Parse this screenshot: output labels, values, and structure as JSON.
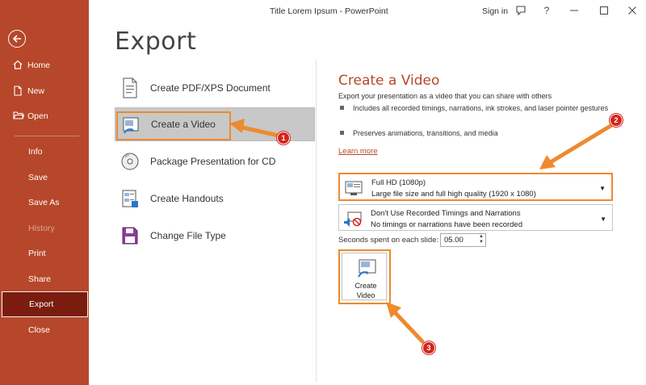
{
  "window": {
    "title": "Title Lorem Ipsum",
    "app_name": "PowerPoint",
    "title_separator": " - ",
    "signin": "Sign in",
    "help": "?"
  },
  "sidebar": {
    "items": [
      {
        "label": "Home",
        "icon": "home-icon"
      },
      {
        "label": "New",
        "icon": "new-file-icon"
      },
      {
        "label": "Open",
        "icon": "open-folder-icon"
      },
      {
        "label": "Info"
      },
      {
        "label": "Save"
      },
      {
        "label": "Save As"
      },
      {
        "label": "History",
        "disabled": true
      },
      {
        "label": "Print"
      },
      {
        "label": "Share"
      },
      {
        "label": "Export",
        "active": true
      },
      {
        "label": "Close"
      }
    ]
  },
  "page": {
    "title": "Export"
  },
  "export_options": [
    {
      "label": "Create PDF/XPS Document",
      "icon": "pdf-document-icon"
    },
    {
      "label": "Create a Video",
      "icon": "video-icon",
      "selected": true
    },
    {
      "label": "Package Presentation for CD",
      "icon": "cd-icon"
    },
    {
      "label": "Create Handouts",
      "icon": "handouts-icon"
    },
    {
      "label": "Change File Type",
      "icon": "change-file-type-icon"
    }
  ],
  "panel": {
    "title": "Create a Video",
    "description": "Export your presentation as a video that you can share with others",
    "bullets": [
      "Includes all recorded timings, narrations, ink strokes, and laser pointer gestures",
      "Preserves animations, transitions, and media"
    ],
    "learn_more": "Learn more",
    "quality_dropdown": {
      "title": "Full HD (1080p)",
      "subtitle": "Large file size and full high quality (1920 x 1080)"
    },
    "timings_dropdown": {
      "title": "Don't Use Recorded Timings and Narrations",
      "subtitle": "No timings or narrations have been recorded"
    },
    "seconds_label": "Seconds spent on each slide:",
    "seconds_value": "05.00",
    "create_button": {
      "line1": "Create",
      "line2": "Video"
    }
  },
  "callouts": [
    {
      "number": "1"
    },
    {
      "number": "2"
    },
    {
      "number": "3"
    }
  ],
  "colors": {
    "brand": "#b7472a",
    "active_nav": "#7a1d0f",
    "highlight": "#ee8a2f",
    "badge": "#d4261c"
  }
}
